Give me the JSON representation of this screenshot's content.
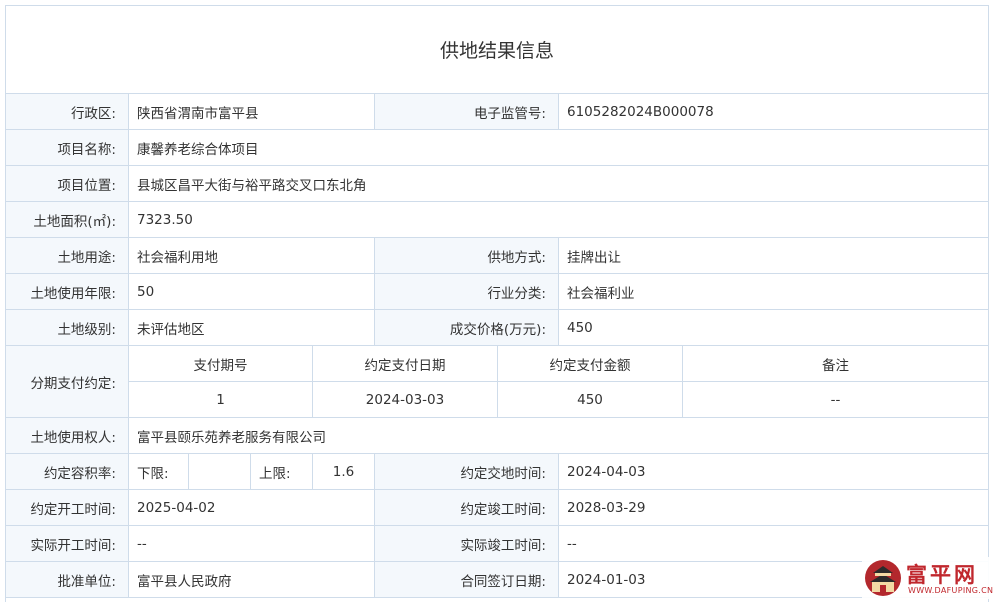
{
  "title": "供地结果信息",
  "fields": {
    "district_label": "行政区:",
    "district_value": "陕西省渭南市富平县",
    "supervision_no_label": "电子监管号:",
    "supervision_no_value": "6105282024B000078",
    "project_name_label": "项目名称:",
    "project_name_value": "康馨养老综合体项目",
    "location_label": "项目位置:",
    "location_value": "县城区昌平大街与裕平路交叉口东北角",
    "area_label": "土地面积(㎡):",
    "area_value": "7323.50",
    "land_use_label": "土地用途:",
    "land_use_value": "社会福利用地",
    "supply_method_label": "供地方式:",
    "supply_method_value": "挂牌出让",
    "term_label": "土地使用年限:",
    "term_value": "50",
    "industry_label": "行业分类:",
    "industry_value": "社会福利业",
    "grade_label": "土地级别:",
    "grade_value": "未评估地区",
    "price_label": "成交价格(万元):",
    "price_value": "450",
    "installment_label": "分期支付约定:",
    "installment_headers": [
      "支付期号",
      "约定支付日期",
      "约定支付金额",
      "备注"
    ],
    "installment_rows": [
      [
        "1",
        "2024-03-03",
        "450",
        "--"
      ]
    ],
    "holder_label": "土地使用权人:",
    "holder_value": "富平县颐乐苑养老服务有限公司",
    "far_label": "约定容积率:",
    "far_lower_label": "下限:",
    "far_lower_value": "",
    "far_upper_label": "上限:",
    "far_upper_value": "1.6",
    "handover_label": "约定交地时间:",
    "handover_value": "2024-04-03",
    "start_label": "约定开工时间:",
    "start_value": "2025-04-02",
    "completion_label": "约定竣工时间:",
    "completion_value": "2028-03-29",
    "actual_start_label": "实际开工时间:",
    "actual_start_value": "--",
    "actual_completion_label": "实际竣工时间:",
    "actual_completion_value": "--",
    "approval_label": "批准单位:",
    "approval_value": "富平县人民政府",
    "contract_date_label": "合同签订日期:",
    "contract_date_value": "2024-01-03"
  },
  "watermark": {
    "name": "富平网",
    "url": "WWW.DAFUPING.CN"
  },
  "colors": {
    "border": "#cfdcea",
    "label_bg": "#f4f8fc",
    "text": "#333333",
    "brand_red": "#c0272d"
  }
}
